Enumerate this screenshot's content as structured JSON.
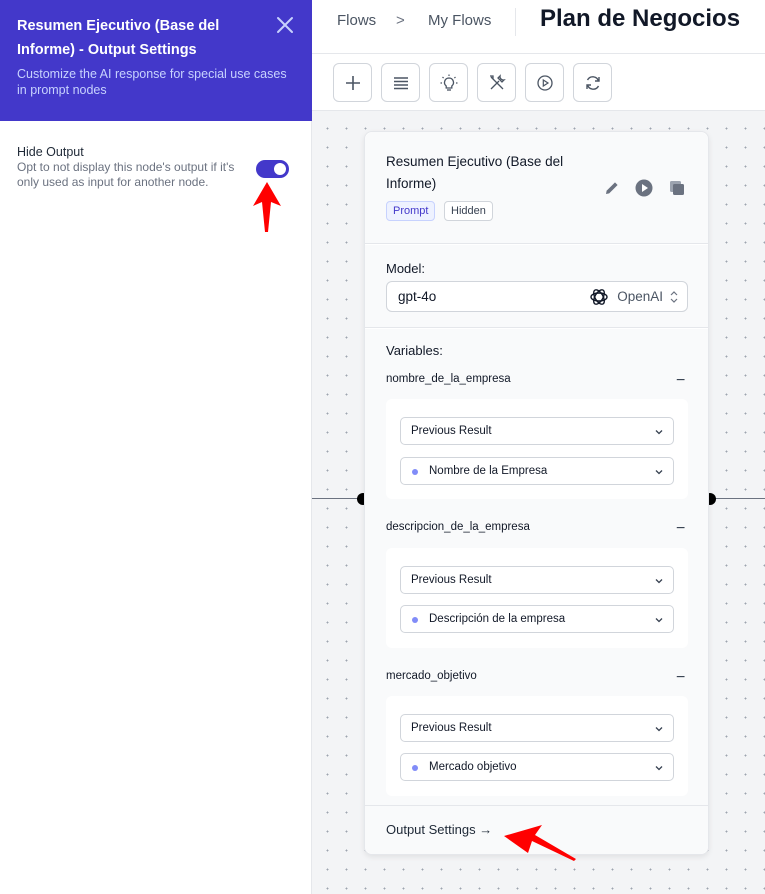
{
  "panel": {
    "title": "Resumen Ejecutivo (Base del Informe) - Output Settings",
    "subtitle": "Customize the AI response for special use cases in prompt nodes",
    "setting_title": "Hide Output",
    "setting_desc": "Opt to not display this node's output if it's only used as input for another node.",
    "toggle_on": true
  },
  "breadcrumb": {
    "flows": "Flows",
    "separator": ">",
    "my_flows": "My Flows"
  },
  "page_title": "Plan de Negocios",
  "toolbar_icons": [
    "plus-icon",
    "list-icon",
    "lightbulb-icon",
    "tools-icon",
    "play-circle-icon",
    "refresh-icon"
  ],
  "node": {
    "title": "Resumen Ejecutivo (Base del Informe)",
    "badges": {
      "prompt": "Prompt",
      "hidden": "Hidden"
    },
    "model_label": "Model:",
    "model_value": "gpt-4o",
    "model_provider": "OpenAI",
    "variables_label": "Variables:",
    "variables": [
      {
        "name": "nombre_de_la_empresa",
        "source": "Previous Result",
        "value": "Nombre de la Empresa"
      },
      {
        "name": "descripcion_de_la_empresa",
        "source": "Previous Result",
        "value": "Descripción de la empresa"
      },
      {
        "name": "mercado_objetivo",
        "source": "Previous Result",
        "value": "Mercado objetivo"
      }
    ],
    "collapse_symbol": "−",
    "output_settings": "Output Settings →"
  },
  "colors": {
    "accent": "#4338ca",
    "annotation": "#ff0000"
  }
}
